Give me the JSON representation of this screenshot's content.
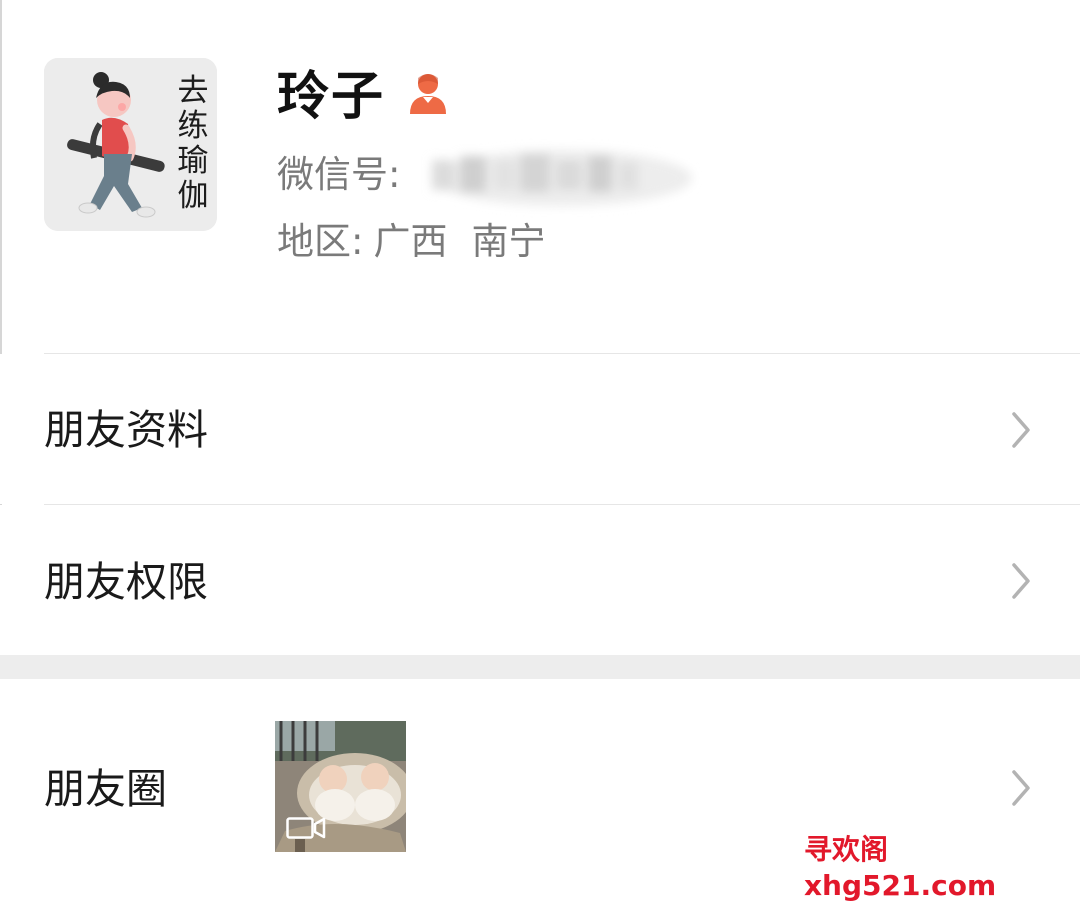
{
  "profile": {
    "avatar_text": "去练瑜伽",
    "name": "玲子",
    "gender_icon": "female-person-icon",
    "wechat_id_label": "微信号:",
    "wechat_id_value_hidden": true,
    "region_label": "地区:",
    "region_province": "广西",
    "region_city": "南宁"
  },
  "menu": {
    "items": [
      {
        "label": "朋友资料",
        "icon": "chevron-right-icon"
      },
      {
        "label": "朋友权限",
        "icon": "chevron-right-icon"
      },
      {
        "label": "朋友圈",
        "icon": "chevron-right-icon",
        "thumbnail": "moments-video-thumbnail"
      }
    ]
  },
  "watermark": {
    "text": "寻欢阁xhg521.com"
  },
  "colors": {
    "gender_icon": "#ee6a45",
    "watermark": "#e2182b",
    "section_gap": "#ededed",
    "secondary_text": "#7a7a7a",
    "chevron": "#b3b3b3"
  }
}
